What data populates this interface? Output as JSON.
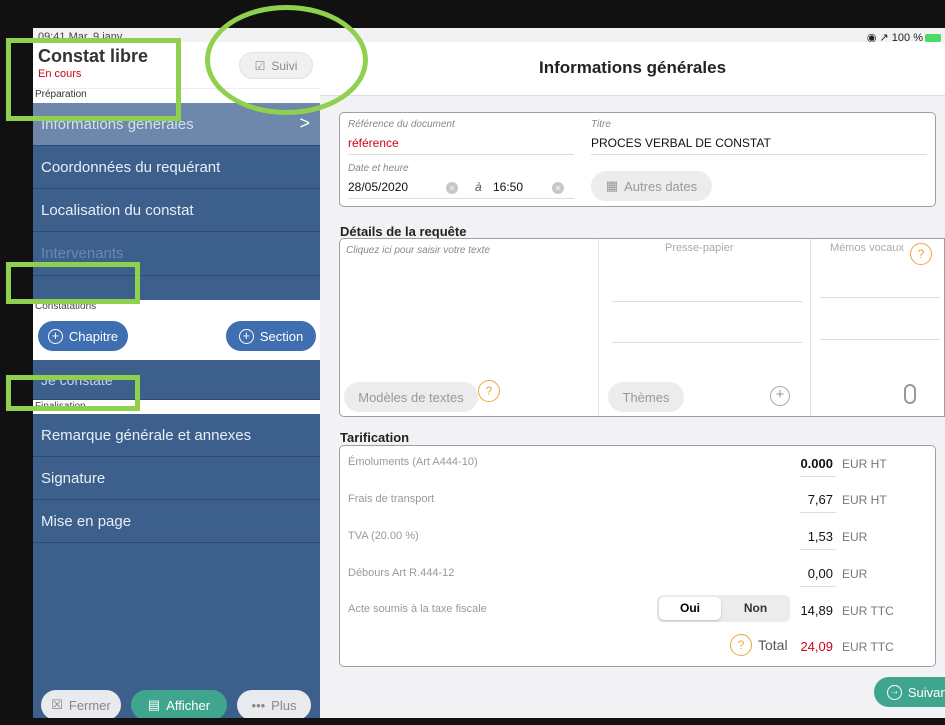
{
  "status": {
    "time": "09:41  Mar. 9 janv.",
    "right": "◉ ↗ 100 %"
  },
  "sidebar": {
    "title": "Constat libre",
    "state": "En cours",
    "section_preparation": "Préparation",
    "suivi_label": "Suivi",
    "items_prep": [
      {
        "label": "Informations générales"
      },
      {
        "label": "Coordonnées du requérant"
      },
      {
        "label": "Localisation du constat"
      },
      {
        "label": "Intervenants"
      }
    ],
    "section_constatations": "Constatations",
    "chapitre_label": "Chapitre",
    "section_label": "Section",
    "je_constate": "Je constate",
    "section_finalisation": "Finalisation",
    "items_final": [
      {
        "label": "Remarque générale et annexes"
      },
      {
        "label": "Signature"
      },
      {
        "label": "Mise en page"
      }
    ],
    "fermer_label": "Fermer",
    "afficher_label": "Afficher",
    "plus_label": "Plus"
  },
  "main": {
    "title": "Informations générales",
    "ref_label": "Référence du document",
    "ref_value": "référence",
    "titre_label": "Titre",
    "titre_value": "PROCES VERBAL DE CONSTAT",
    "date_label": "Date et heure",
    "date_value": "28/05/2020",
    "a_label": "à",
    "time_value": "16:50",
    "autres_dates": "Autres dates",
    "details_title": "Détails de la requête",
    "placeholder": "Cliquez ici pour saisir votre texte",
    "presse_papier": "Presse-papier",
    "memos_vocaux": "Mémos vocaux",
    "modeles": "Modèles de textes",
    "themes": "Thèmes",
    "tarif_title": "Tarification",
    "tarif_rows": [
      {
        "label": "Émoluments (Art A444-10)",
        "value": "0.000",
        "unit": "EUR HT"
      },
      {
        "label": "Frais de transport",
        "value": "7,67",
        "unit": "EUR HT"
      },
      {
        "label": "TVA (20.00 %)",
        "value": "1,53",
        "unit": "EUR"
      },
      {
        "label": "Débours Art R.444-12",
        "value": "0,00",
        "unit": "EUR"
      },
      {
        "label": "Acte soumis à la taxe fiscale",
        "value": "14,89",
        "unit": "EUR TTC"
      }
    ],
    "oui": "Oui",
    "non": "Non",
    "total_label": "Total",
    "total_value": "24,09",
    "total_unit": "EUR TTC",
    "suivant": "Suivant"
  },
  "colors": {
    "sidebar": "#3d5f8c",
    "accent_green": "#8fd14f",
    "red": "#d0021b",
    "teal": "#3fa58e"
  }
}
